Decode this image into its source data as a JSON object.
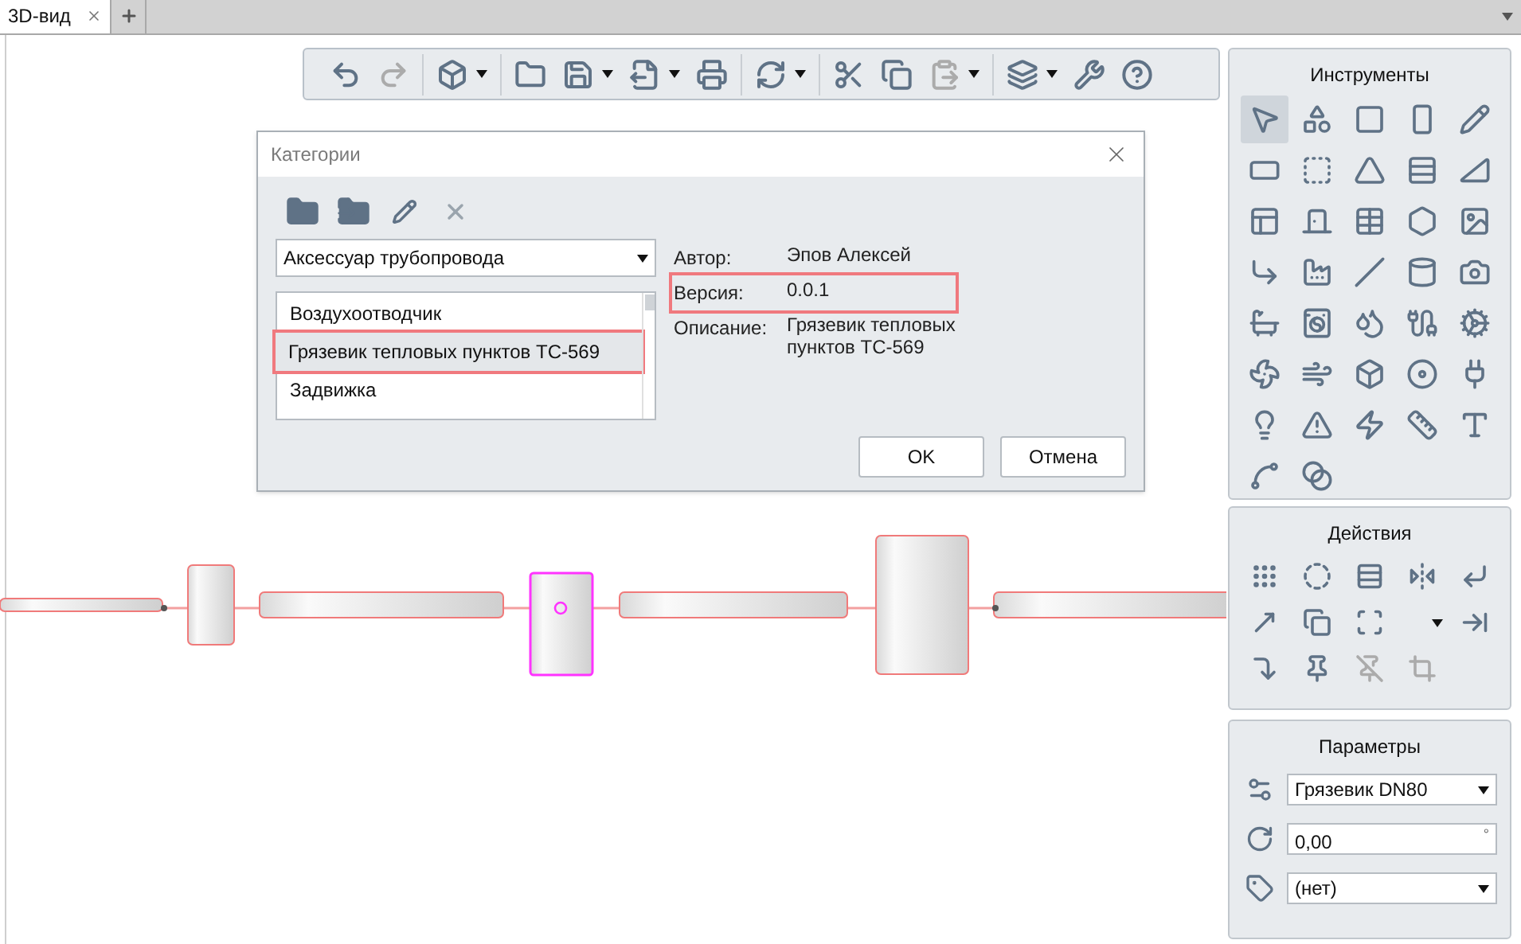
{
  "tabs": [
    {
      "label": "3D-вид",
      "selected": true,
      "closable": true
    }
  ],
  "toolbar": {
    "groups": [
      [
        {
          "disabled": false,
          "dropdown": false
        },
        {
          "disabled": true,
          "dropdown": false
        }
      ],
      [
        {
          "disabled": false,
          "dropdown": true
        }
      ],
      [
        {
          "disabled": false,
          "dropdown": false
        },
        {
          "disabled": false,
          "dropdown": true
        },
        {
          "disabled": false,
          "dropdown": true
        },
        {
          "disabled": false,
          "dropdown": false
        }
      ],
      [
        {
          "disabled": false,
          "dropdown": true
        }
      ],
      [
        {
          "disabled": false,
          "dropdown": false
        },
        {
          "disabled": false,
          "dropdown": false
        },
        {
          "disabled": true,
          "dropdown": true
        }
      ],
      [
        {
          "disabled": false,
          "dropdown": true
        },
        {
          "disabled": false,
          "dropdown": false
        },
        {
          "disabled": false,
          "dropdown": false
        }
      ]
    ]
  },
  "dialog": {
    "title": "Категории",
    "toolbar": [
      {
        "disabled": false
      },
      {
        "disabled": false
      },
      {
        "disabled": false
      },
      {
        "disabled": true
      }
    ],
    "category": "Аксессуар трубопровода",
    "items": [
      {
        "label": "Воздухоотводчик",
        "selected": false
      },
      {
        "label": "Грязевик тепловых пунктов ТС-569",
        "selected": true
      },
      {
        "label": "Задвижка",
        "selected": false
      }
    ],
    "info": [
      {
        "label": "Автор:",
        "value": "Эпов Алексей",
        "highlighted": false
      },
      {
        "label": "Версия:",
        "value": "0.0.1",
        "highlighted": true
      },
      {
        "label": "Описание:",
        "value": "Грязевик тепловых пунктов ТС-569",
        "highlighted": false
      }
    ],
    "buttons": [
      "OK",
      "Отмена"
    ]
  },
  "tools_panel": {
    "title": "Инструменты",
    "tools": [
      {
        "selected": true
      },
      {
        "selected": false
      },
      {
        "selected": false
      },
      {
        "selected": false
      },
      {
        "selected": false
      },
      {
        "selected": false
      },
      {
        "selected": false
      },
      {
        "selected": false
      },
      {
        "selected": false
      },
      {
        "selected": false
      },
      {
        "selected": false
      },
      {
        "selected": false
      },
      {
        "selected": false
      },
      {
        "selected": false
      },
      {
        "selected": false
      },
      {
        "selected": false
      },
      {
        "selected": false
      },
      {
        "selected": false
      },
      {
        "selected": false
      },
      {
        "selected": false
      },
      {
        "selected": false
      },
      {
        "selected": false
      },
      {
        "selected": false
      },
      {
        "selected": false
      },
      {
        "selected": false
      },
      {
        "selected": false
      },
      {
        "selected": false
      },
      {
        "selected": false
      },
      {
        "selected": false
      },
      {
        "selected": false
      },
      {
        "selected": false
      },
      {
        "selected": false
      },
      {
        "selected": false
      },
      {
        "selected": false
      },
      {
        "selected": false
      },
      {
        "selected": false
      },
      {
        "selected": false
      }
    ]
  },
  "actions_panel": {
    "title": "Действия",
    "actions": [
      {
        "kind": "button",
        "disabled": false
      },
      {
        "kind": "button",
        "disabled": false
      },
      {
        "kind": "button",
        "disabled": false
      },
      {
        "kind": "button",
        "disabled": false
      },
      {
        "kind": "button",
        "disabled": false
      },
      {
        "kind": "button",
        "disabled": false
      },
      {
        "kind": "button",
        "disabled": false
      },
      {
        "kind": "button",
        "disabled": false
      },
      {
        "kind": "dropdown",
        "disabled": false
      },
      {
        "kind": "button",
        "disabled": false
      },
      {
        "kind": "button",
        "disabled": false
      },
      {
        "kind": "button",
        "disabled": false
      },
      {
        "kind": "button",
        "disabled": true
      },
      {
        "kind": "button",
        "disabled": true
      }
    ]
  },
  "parameters_panel": {
    "title": "Параметры",
    "fields": [
      {
        "kind": "select",
        "value": "Грязевик DN80"
      },
      {
        "kind": "input",
        "value": "0,00",
        "unit": "°"
      },
      {
        "kind": "select",
        "value": "(нет)"
      }
    ]
  }
}
